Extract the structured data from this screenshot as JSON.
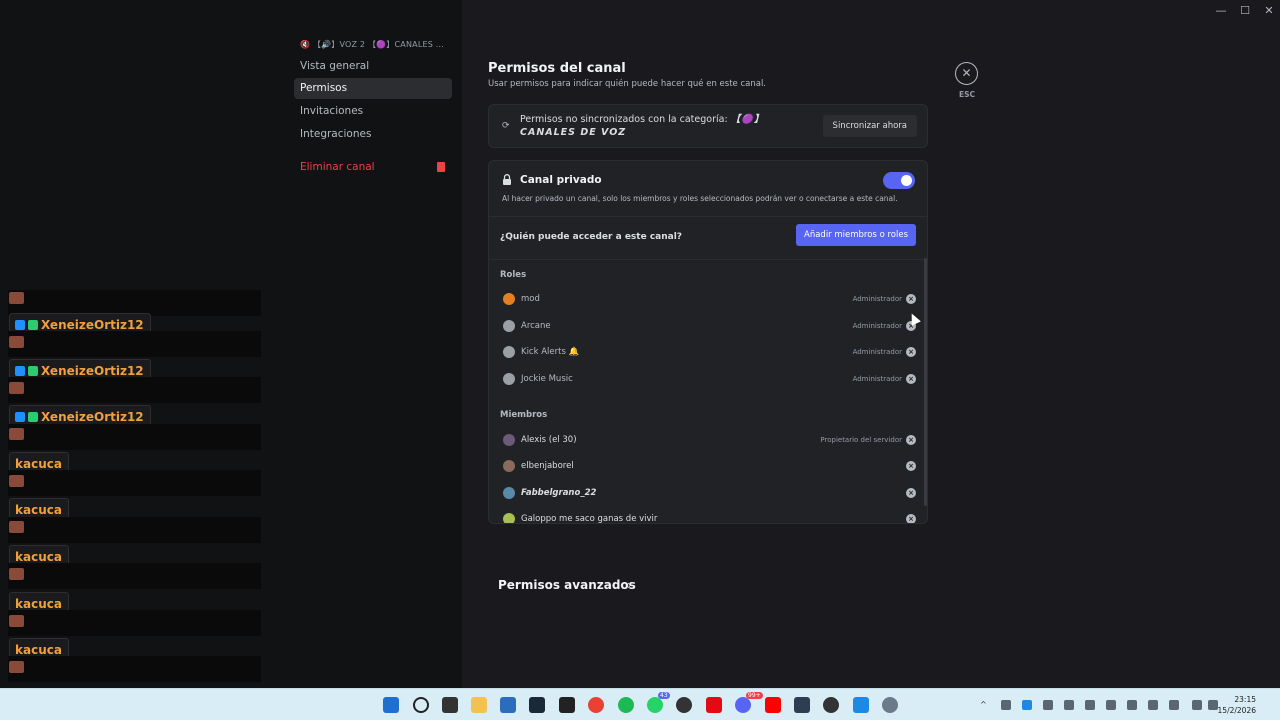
{
  "window_controls": {
    "minimize": "—",
    "maximize": "☐",
    "close": "✕"
  },
  "sidebar": {
    "header": "🔇 【🔊】VOZ 2  【🟣】CANALES ...",
    "items": [
      {
        "label": "Vista general"
      },
      {
        "label": "Permisos"
      },
      {
        "label": "Invitaciones"
      },
      {
        "label": "Integraciones"
      }
    ],
    "delete_label": "Eliminar canal"
  },
  "overlay": {
    "names": [
      "XeneizeOrtiz12",
      "XeneizeOrtiz12",
      "XeneizeOrtiz12",
      "kacuca",
      "kacuca",
      "kacuca",
      "kacuca",
      "kacuca"
    ]
  },
  "page": {
    "title": "Permisos del canal",
    "subtitle": "Usar permisos para indicar quién puede hacer qué en este canal.",
    "close_label": "ESC"
  },
  "sync": {
    "text": "Permisos no sincronizados con la categoría:",
    "category": "【🟣】CANALES DE VOZ",
    "button": "Sincronizar ahora"
  },
  "private": {
    "title": "Canal privado",
    "description": "Al hacer privado un canal, solo los miembros y roles seleccionados podrán ver o conectarse a este canal.",
    "who_label": "¿Quién puede acceder a este canal?",
    "add_button": "Añadir miembros o roles",
    "enabled": true
  },
  "roles_header": "Roles",
  "roles": [
    {
      "name": "mod",
      "tag": "Administrador",
      "color": "#e67e22"
    },
    {
      "name": "Arcane",
      "tag": "Administrador",
      "color": "#9aa0a6"
    },
    {
      "name": "Kick Alerts 🔔",
      "tag": "Administrador",
      "color": "#9aa0a6"
    },
    {
      "name": "Jockie Music",
      "tag": "Administrador",
      "color": "#9aa0a6"
    }
  ],
  "members_header": "Miembros",
  "members": [
    {
      "name": "Alexis (el 30)",
      "tag": "Propietario del servidor",
      "color": "#6b5a7a"
    },
    {
      "name": "elbenjaborel",
      "tag": "",
      "color": "#8a6a5a"
    },
    {
      "name": "Fabbelgrano_22",
      "tag": "",
      "color": "#5a8aaa"
    },
    {
      "name": "Galoppo me saco ganas de vivir",
      "tag": "",
      "color": "#a8c050"
    }
  ],
  "advanced": "Permisos avanzados",
  "taskbar": {
    "time": "23:15",
    "date": "15/2/2026",
    "badges": [
      "43",
      "99+"
    ]
  }
}
